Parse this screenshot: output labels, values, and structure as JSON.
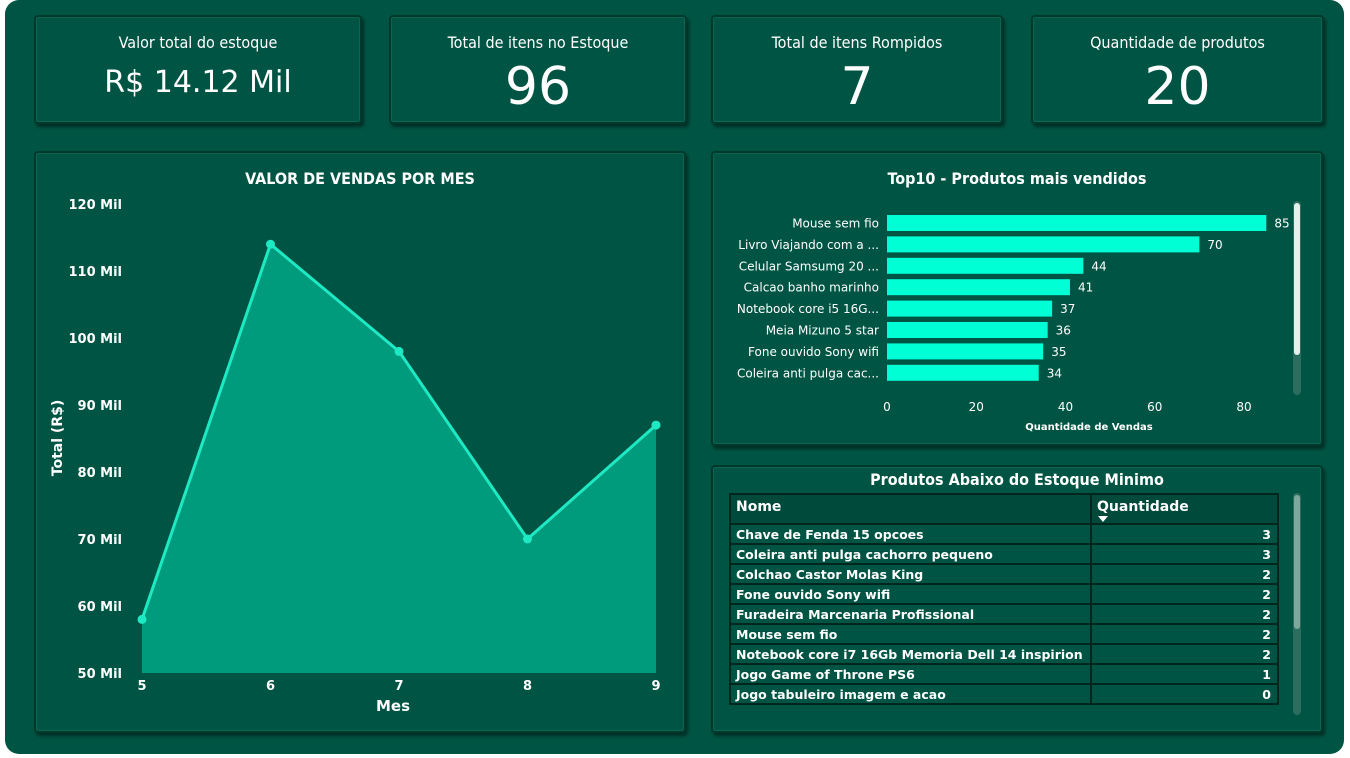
{
  "kpis": {
    "stock_value": {
      "title": "Valor total do estoque",
      "value": "R$ 14.12 Mil"
    },
    "stock_items": {
      "title": "Total de itens no Estoque",
      "value": "96"
    },
    "broken_items": {
      "title": "Total de itens Rompidos",
      "value": "7"
    },
    "product_count": {
      "title": "Quantidade de produtos",
      "value": "20"
    }
  },
  "colors": {
    "background": "#005443",
    "area_fill": "#009b7d",
    "line": "#1de9c3",
    "bar": "#00ffd5",
    "text": "#ffffff"
  },
  "chart_data": [
    {
      "type": "area",
      "title": "VALOR DE VENDAS POR MES",
      "xlabel": "Mes",
      "ylabel": "Total (R$)",
      "x": [
        5,
        6,
        7,
        8,
        9
      ],
      "values": [
        58,
        114,
        98,
        70,
        87
      ],
      "ylim": [
        50,
        120
      ],
      "yticks": [
        50,
        60,
        70,
        80,
        90,
        100,
        110,
        120
      ],
      "ytick_labels": [
        "50 Mil",
        "60 Mil",
        "70 Mil",
        "80 Mil",
        "90 Mil",
        "100 Mil",
        "110 Mil",
        "120 Mil"
      ],
      "grid": false
    },
    {
      "type": "bar",
      "orientation": "horizontal",
      "title": "Top10 - Produtos mais vendidos",
      "xlabel": "Quantidade de Vendas",
      "categories": [
        "Mouse sem fio",
        "Livro Viajando com a ...",
        "Celular Samsumg 20 ...",
        "Calcao banho marinho",
        "Notebook core i5 16G...",
        "Meia Mizuno 5 star",
        "Fone ouvido Sony wifi",
        "Coleira anti pulga cac..."
      ],
      "values": [
        85,
        70,
        44,
        41,
        37,
        36,
        35,
        34
      ],
      "xlim": [
        0,
        90
      ],
      "xticks": [
        0,
        20,
        40,
        60,
        80
      ],
      "grid": false
    }
  ],
  "table": {
    "title": "Produtos Abaixo do Estoque Minimo",
    "col_name": "Nome",
    "col_qty": "Quantidade",
    "rows": [
      {
        "name": "Chave de Fenda 15 opcoes",
        "qty": "3"
      },
      {
        "name": "Coleira anti pulga cachorro pequeno",
        "qty": "3"
      },
      {
        "name": "Colchao Castor Molas King",
        "qty": "2"
      },
      {
        "name": "Fone ouvido Sony wifi",
        "qty": "2"
      },
      {
        "name": "Furadeira Marcenaria Profissional",
        "qty": "2"
      },
      {
        "name": "Mouse sem fio",
        "qty": "2"
      },
      {
        "name": "Notebook core i7 16Gb Memoria Dell 14 inspirion",
        "qty": "2"
      },
      {
        "name": "Jogo Game of Throne PS6",
        "qty": "1"
      },
      {
        "name": "Jogo tabuleiro imagem e acao",
        "qty": "0"
      }
    ]
  }
}
